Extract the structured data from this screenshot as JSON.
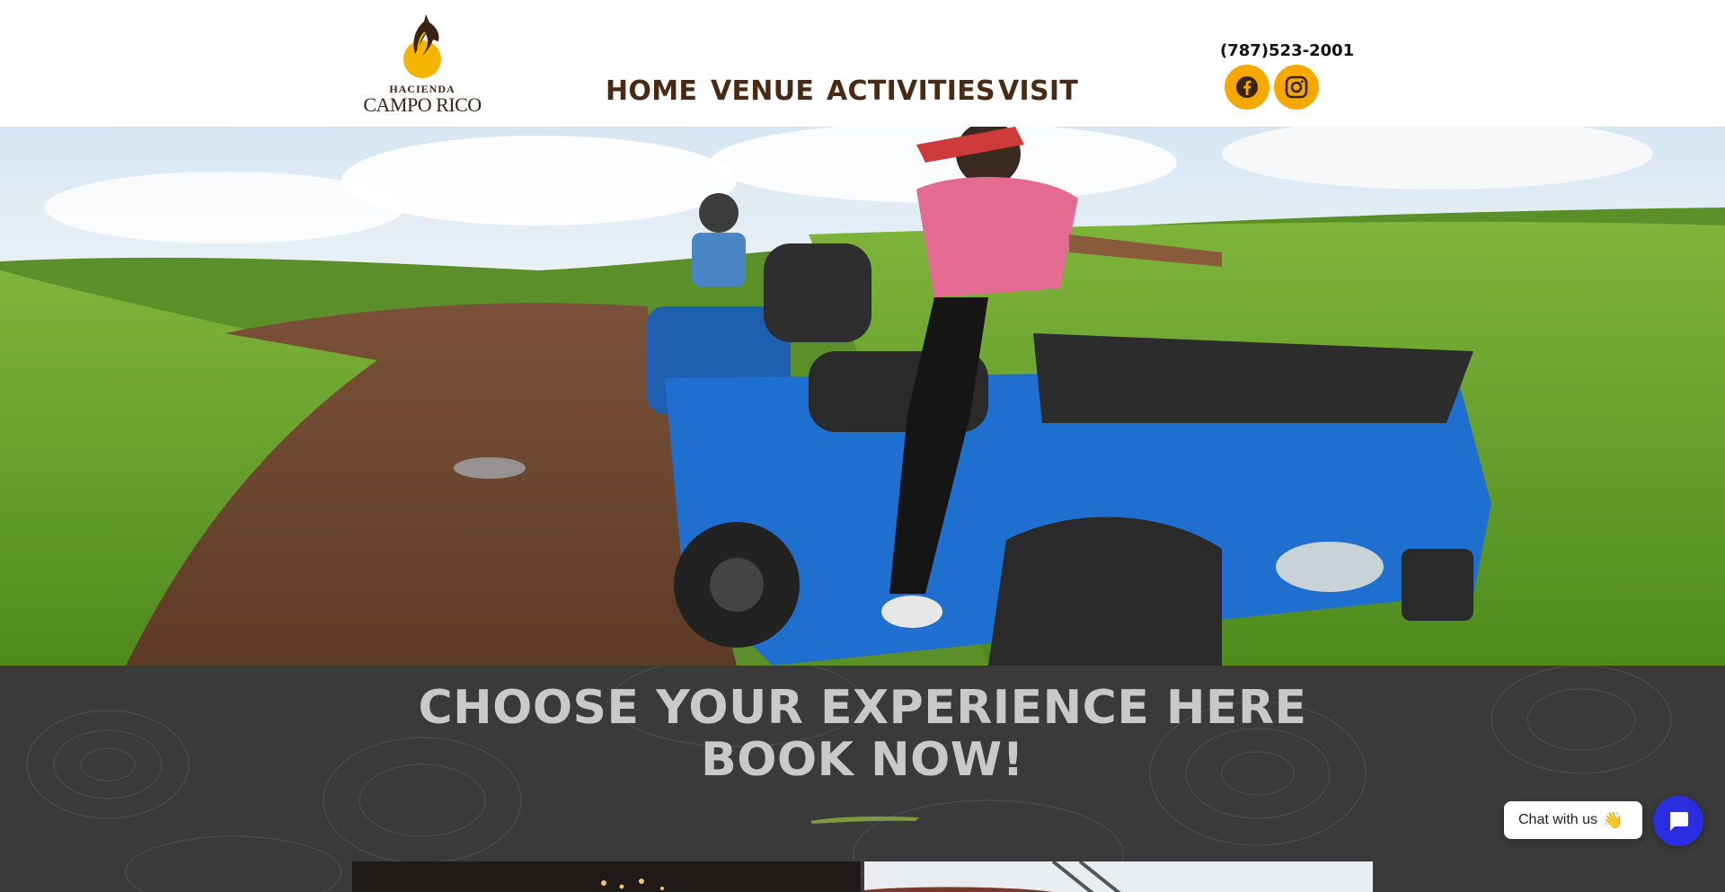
{
  "header": {
    "logo": {
      "line1": "HACIENDA",
      "line2": "CAMPO RICO",
      "icon": "horse-head-logo-icon"
    },
    "nav": [
      {
        "label": "HOME"
      },
      {
        "label": "VENUE"
      },
      {
        "label": "ACTIVITIES"
      },
      {
        "label": "VISIT"
      }
    ],
    "phone": "(787)523-2001",
    "social": [
      {
        "icon": "facebook-icon"
      },
      {
        "icon": "instagram-icon"
      }
    ]
  },
  "hero": {
    "image": "atv-riders-on-dirt-trail-photo"
  },
  "booking": {
    "title_line1": "CHOOSE YOUR EXPERIENCE HERE",
    "title_line2": "BOOK NOW!"
  },
  "chat": {
    "label": "Chat with us",
    "emoji": "👋",
    "icon": "chat-icon"
  },
  "colors": {
    "brand_brown": "#4a2a14",
    "brand_gold": "#f5a800",
    "section_dark": "#3a3a3a",
    "chat_blue": "#2b2ee0"
  }
}
